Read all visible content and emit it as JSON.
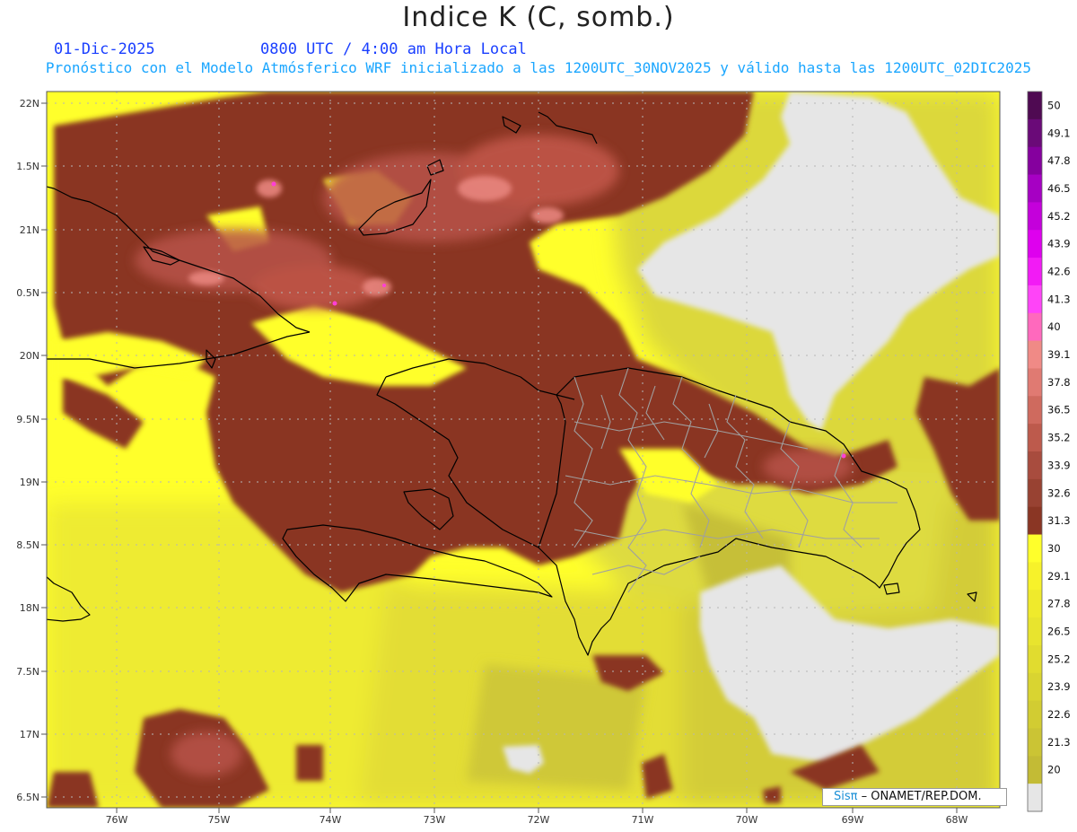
{
  "title": "Indice K (C, somb.)",
  "header": {
    "date": "01-Dic-2025",
    "valid_time": "0800 UTC / 4:00 am Hora Local",
    "subtitle": "Pronóstico con el Modelo Atmósferico WRF inicializado a las 1200UTC_30NOV2025 y válido hasta las  1200UTC_02DIC2025"
  },
  "map": {
    "projection_extent": {
      "lon_min": -76.65,
      "lon_max": -67.4,
      "lat_min": 6.35,
      "lat_max": 22.1
    },
    "lat_labels": [
      "22N",
      "1.5N",
      "21N",
      "0.5N",
      "20N",
      "9.5N",
      "19N",
      "8.5N",
      "18N",
      "7.5N",
      "17N",
      "6.5N"
    ],
    "lon_labels": [
      "76W",
      "75W",
      "74W",
      "73W",
      "72W",
      "71W",
      "70W",
      "69W",
      "68W"
    ],
    "colors": {
      "above_30": "#8a3624",
      "high_core": "#c4584c",
      "peak": "#e8857e",
      "extreme": "#ff3fd6",
      "low_yellow": "#ffff2b",
      "mid_yellow": "#e7e84a",
      "olive": "#c9c13c",
      "below_20": "#e6e6e6",
      "coastline": "#000000",
      "province_borders": "#a0a0a0"
    }
  },
  "legend": {
    "levels": [
      {
        "label": "50",
        "color": "#4f0a52"
      },
      {
        "label": "49.1",
        "color": "#6a0a78"
      },
      {
        "label": "47.8",
        "color": "#85009e"
      },
      {
        "label": "46.5",
        "color": "#a600c3"
      },
      {
        "label": "45.2",
        "color": "#c400db"
      },
      {
        "label": "43.9",
        "color": "#de00ee"
      },
      {
        "label": "42.6",
        "color": "#f21bf5"
      },
      {
        "label": "41.3",
        "color": "#ff44f8"
      },
      {
        "label": "40",
        "color": "#ff69bd"
      },
      {
        "label": "39.1",
        "color": "#f08a86"
      },
      {
        "label": "37.8",
        "color": "#e07a72"
      },
      {
        "label": "36.5",
        "color": "#cf6a5e"
      },
      {
        "label": "35.2",
        "color": "#bd5a4c"
      },
      {
        "label": "33.9",
        "color": "#a84c3e"
      },
      {
        "label": "32.6",
        "color": "#984232"
      },
      {
        "label": "31.3",
        "color": "#8a3624"
      },
      {
        "label": "30",
        "color": "#ffff2b"
      },
      {
        "label": "29.1",
        "color": "#f7f22a"
      },
      {
        "label": "27.8",
        "color": "#efea2c"
      },
      {
        "label": "26.5",
        "color": "#e8e42e"
      },
      {
        "label": "25.2",
        "color": "#e1dc2f"
      },
      {
        "label": "23.9",
        "color": "#d9d431"
      },
      {
        "label": "22.6",
        "color": "#d2cc32"
      },
      {
        "label": "21.3",
        "color": "#cbc434"
      },
      {
        "label": "20",
        "color": "#c3bb35"
      },
      {
        "label": "",
        "color": "#e6e6e6"
      }
    ]
  },
  "credit": {
    "brand": "Sisπ",
    "org": " – ONAMET/REP.DOM."
  }
}
